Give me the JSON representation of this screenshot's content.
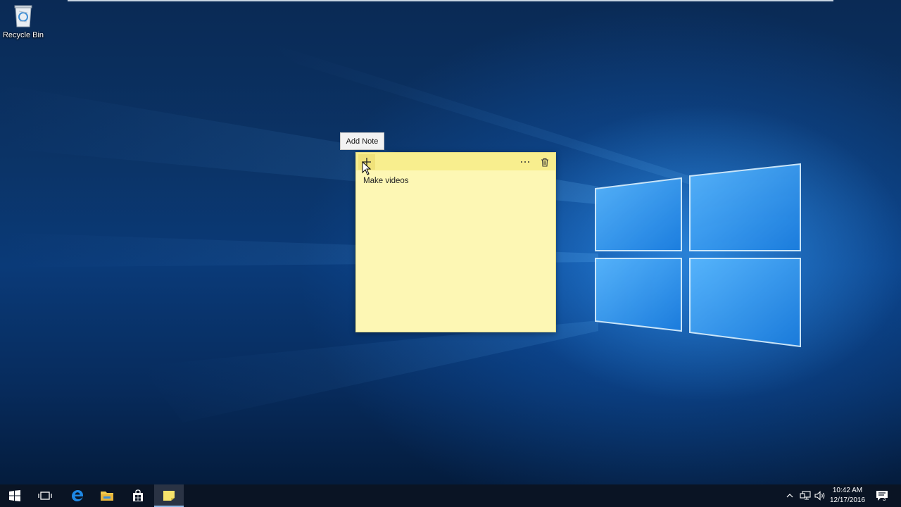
{
  "desktop": {
    "icons": [
      {
        "label": "Recycle Bin",
        "icon": "recycle-bin-icon"
      }
    ]
  },
  "sticky_note": {
    "tooltip": "Add Note",
    "text": "Make videos",
    "header_icons": [
      "add-note-icon",
      "menu-ellipsis-icon",
      "delete-note-icon"
    ],
    "colors": {
      "note": "#fdf7b4",
      "header": "#f8ee8e"
    }
  },
  "taskbar": {
    "pinned": [
      "start-icon",
      "task-view-icon",
      "edge-icon",
      "file-explorer-icon",
      "store-icon",
      "sticky-notes-icon"
    ],
    "active_app": "sticky-notes-icon",
    "tray": {
      "time": "10:42 AM",
      "date": "12/17/2016",
      "notification_count": "3",
      "icons": [
        "show-hidden-icons-icon",
        "network-icon",
        "volume-icon",
        "action-center-icon"
      ]
    }
  }
}
